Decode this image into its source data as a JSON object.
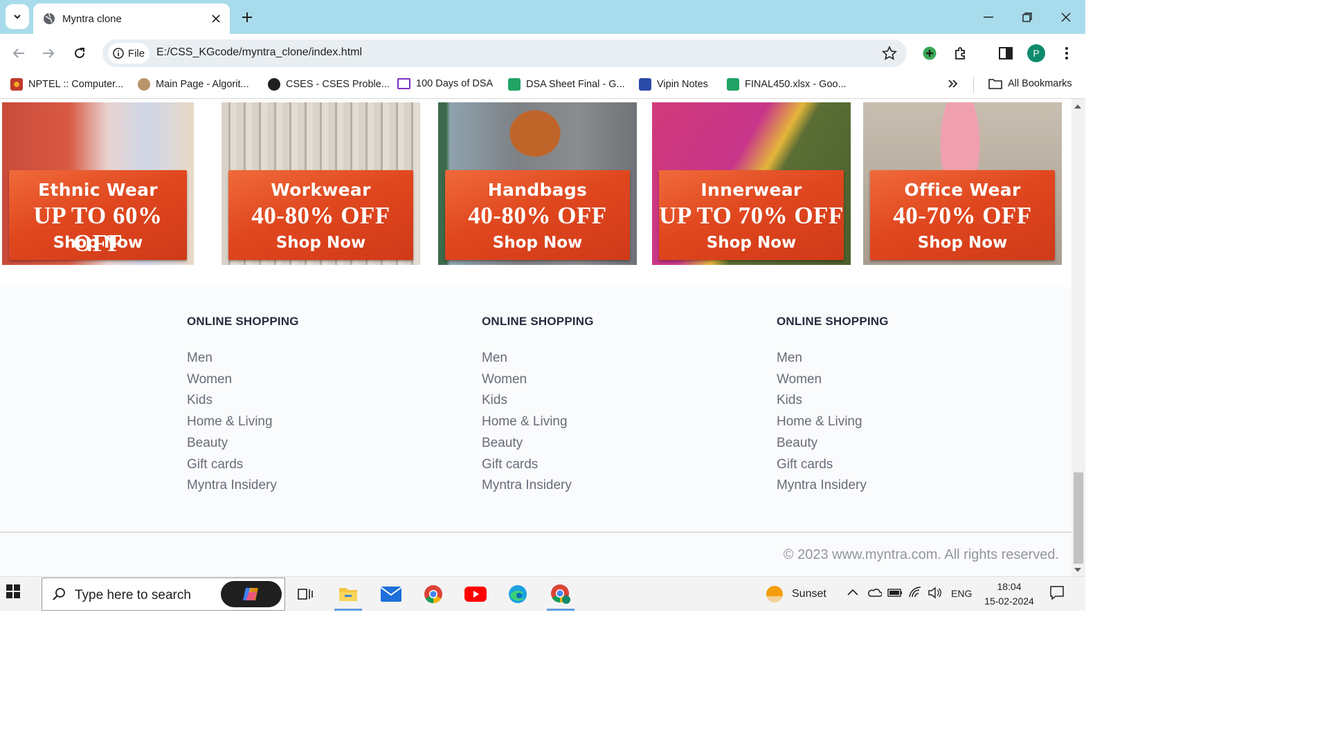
{
  "browser": {
    "tab_title": "Myntra clone",
    "address_chip": "File",
    "url": "E:/CSS_KGcode/myntra_clone/index.html",
    "profile_initial": "P",
    "bookmarks": [
      {
        "label": "NPTEL :: Computer...",
        "icon": "nptel-icon",
        "color": "#c0392b"
      },
      {
        "label": "Main Page - Algorit...",
        "icon": "algorithmica-icon",
        "color": "#8a6d3b"
      },
      {
        "label": "CSES - CSES Proble...",
        "icon": "cses-icon",
        "color": "#1f1f1f"
      },
      {
        "label": "100 Days of DSA",
        "icon": "presentation-icon",
        "color": "#7b2fbf"
      },
      {
        "label": "DSA Sheet Final - G...",
        "icon": "sheets-icon",
        "color": "#21a366"
      },
      {
        "label": "Vipin Notes",
        "icon": "notes-icon",
        "color": "#2b4aa8"
      },
      {
        "label": "FINAL450.xlsx - Goo...",
        "icon": "sheets-icon",
        "color": "#21a366"
      }
    ],
    "all_bookmarks": "All Bookmarks"
  },
  "banners": [
    {
      "category": "Ethnic Wear",
      "offer": "UP TO 60% OFF",
      "cta": "Shop Now",
      "photo_color": "#c94a3a"
    },
    {
      "category": "Workwear",
      "offer": "40-80% OFF",
      "cta": "Shop Now",
      "photo_color": "#8d8a84"
    },
    {
      "category": "Handbags",
      "offer": "40-80% OFF",
      "cta": "Shop Now",
      "photo_color": "#7d8185"
    },
    {
      "category": "Innerwear",
      "offer": "UP TO 70% OFF",
      "cta": "Shop Now",
      "photo_color": "#5a6e35"
    },
    {
      "category": "Office Wear",
      "offer": "40-70% OFF",
      "cta": "Shop Now",
      "photo_color": "#b5a99a"
    }
  ],
  "footer": {
    "columns": [
      {
        "heading": "ONLINE SHOPPING",
        "links": [
          "Men",
          "Women",
          "Kids",
          "Home & Living",
          "Beauty",
          "Gift cards",
          "Myntra Insidery"
        ]
      },
      {
        "heading": "ONLINE SHOPPING",
        "links": [
          "Men",
          "Women",
          "Kids",
          "Home & Living",
          "Beauty",
          "Gift cards",
          "Myntra Insidery"
        ]
      },
      {
        "heading": "ONLINE SHOPPING",
        "links": [
          "Men",
          "Women",
          "Kids",
          "Home & Living",
          "Beauty",
          "Gift cards",
          "Myntra Insidery"
        ]
      }
    ],
    "copyright": "© 2023 www.myntra.com. All rights reserved."
  },
  "taskbar": {
    "search_placeholder": "Type here to search",
    "weather": "Sunset",
    "language": "ENG",
    "time": "18:04",
    "date": "15-02-2024"
  }
}
